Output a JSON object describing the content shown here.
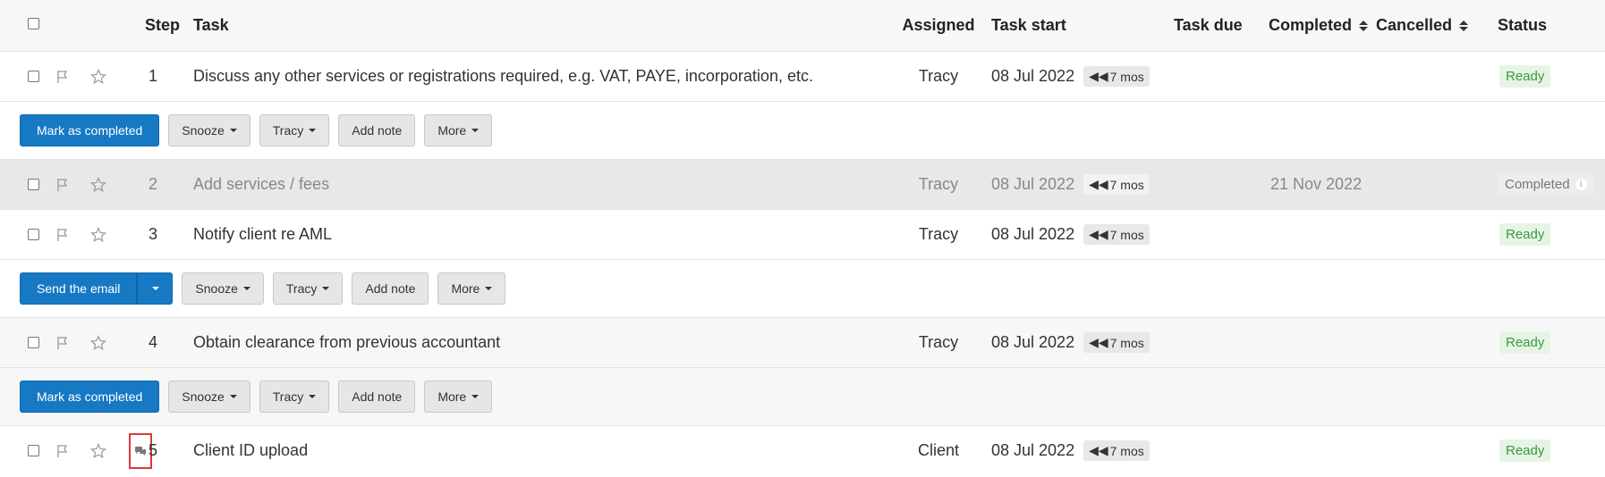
{
  "header": {
    "step": "Step",
    "task": "Task",
    "assigned": "Assigned",
    "task_start": "Task start",
    "task_due": "Task due",
    "completed": "Completed",
    "cancelled": "Cancelled",
    "status": "Status"
  },
  "tasks": [
    {
      "step": "1",
      "task": "Discuss any other services or registrations required, e.g. VAT, PAYE, incorporation, etc.",
      "assigned": "Tracy",
      "start": "08 Jul 2022",
      "ago": "7 mos",
      "completed": "",
      "status": "Ready"
    },
    {
      "step": "2",
      "task": "Add services / fees",
      "assigned": "Tracy",
      "start": "08 Jul 2022",
      "ago": "7 mos",
      "completed": "21 Nov 2022",
      "status": "Completed"
    },
    {
      "step": "3",
      "task": "Notify client re AML",
      "assigned": "Tracy",
      "start": "08 Jul 2022",
      "ago": "7 mos",
      "completed": "",
      "status": "Ready"
    },
    {
      "step": "4",
      "task": "Obtain clearance from previous accountant",
      "assigned": "Tracy",
      "start": "08 Jul 2022",
      "ago": "7 mos",
      "completed": "",
      "status": "Ready"
    },
    {
      "step": "5",
      "task": "Client ID upload",
      "assigned": "Client",
      "start": "08 Jul 2022",
      "ago": "7 mos",
      "completed": "",
      "status": "Ready"
    }
  ],
  "actions": {
    "mark_completed": "Mark as completed",
    "send_email": "Send the email",
    "snooze": "Snooze",
    "assignee": "Tracy",
    "add_note": "Add note",
    "more": "More"
  },
  "colors": {
    "primary": "#1778c4",
    "ready_text": "#3b9a3b",
    "ready_bg": "#e6f4e6",
    "highlight_box": "#d93a3a"
  },
  "icons": [
    "flag-icon",
    "star-icon",
    "rewind-icon",
    "comments-icon",
    "info-icon",
    "caret-down-icon",
    "sort-icon"
  ]
}
